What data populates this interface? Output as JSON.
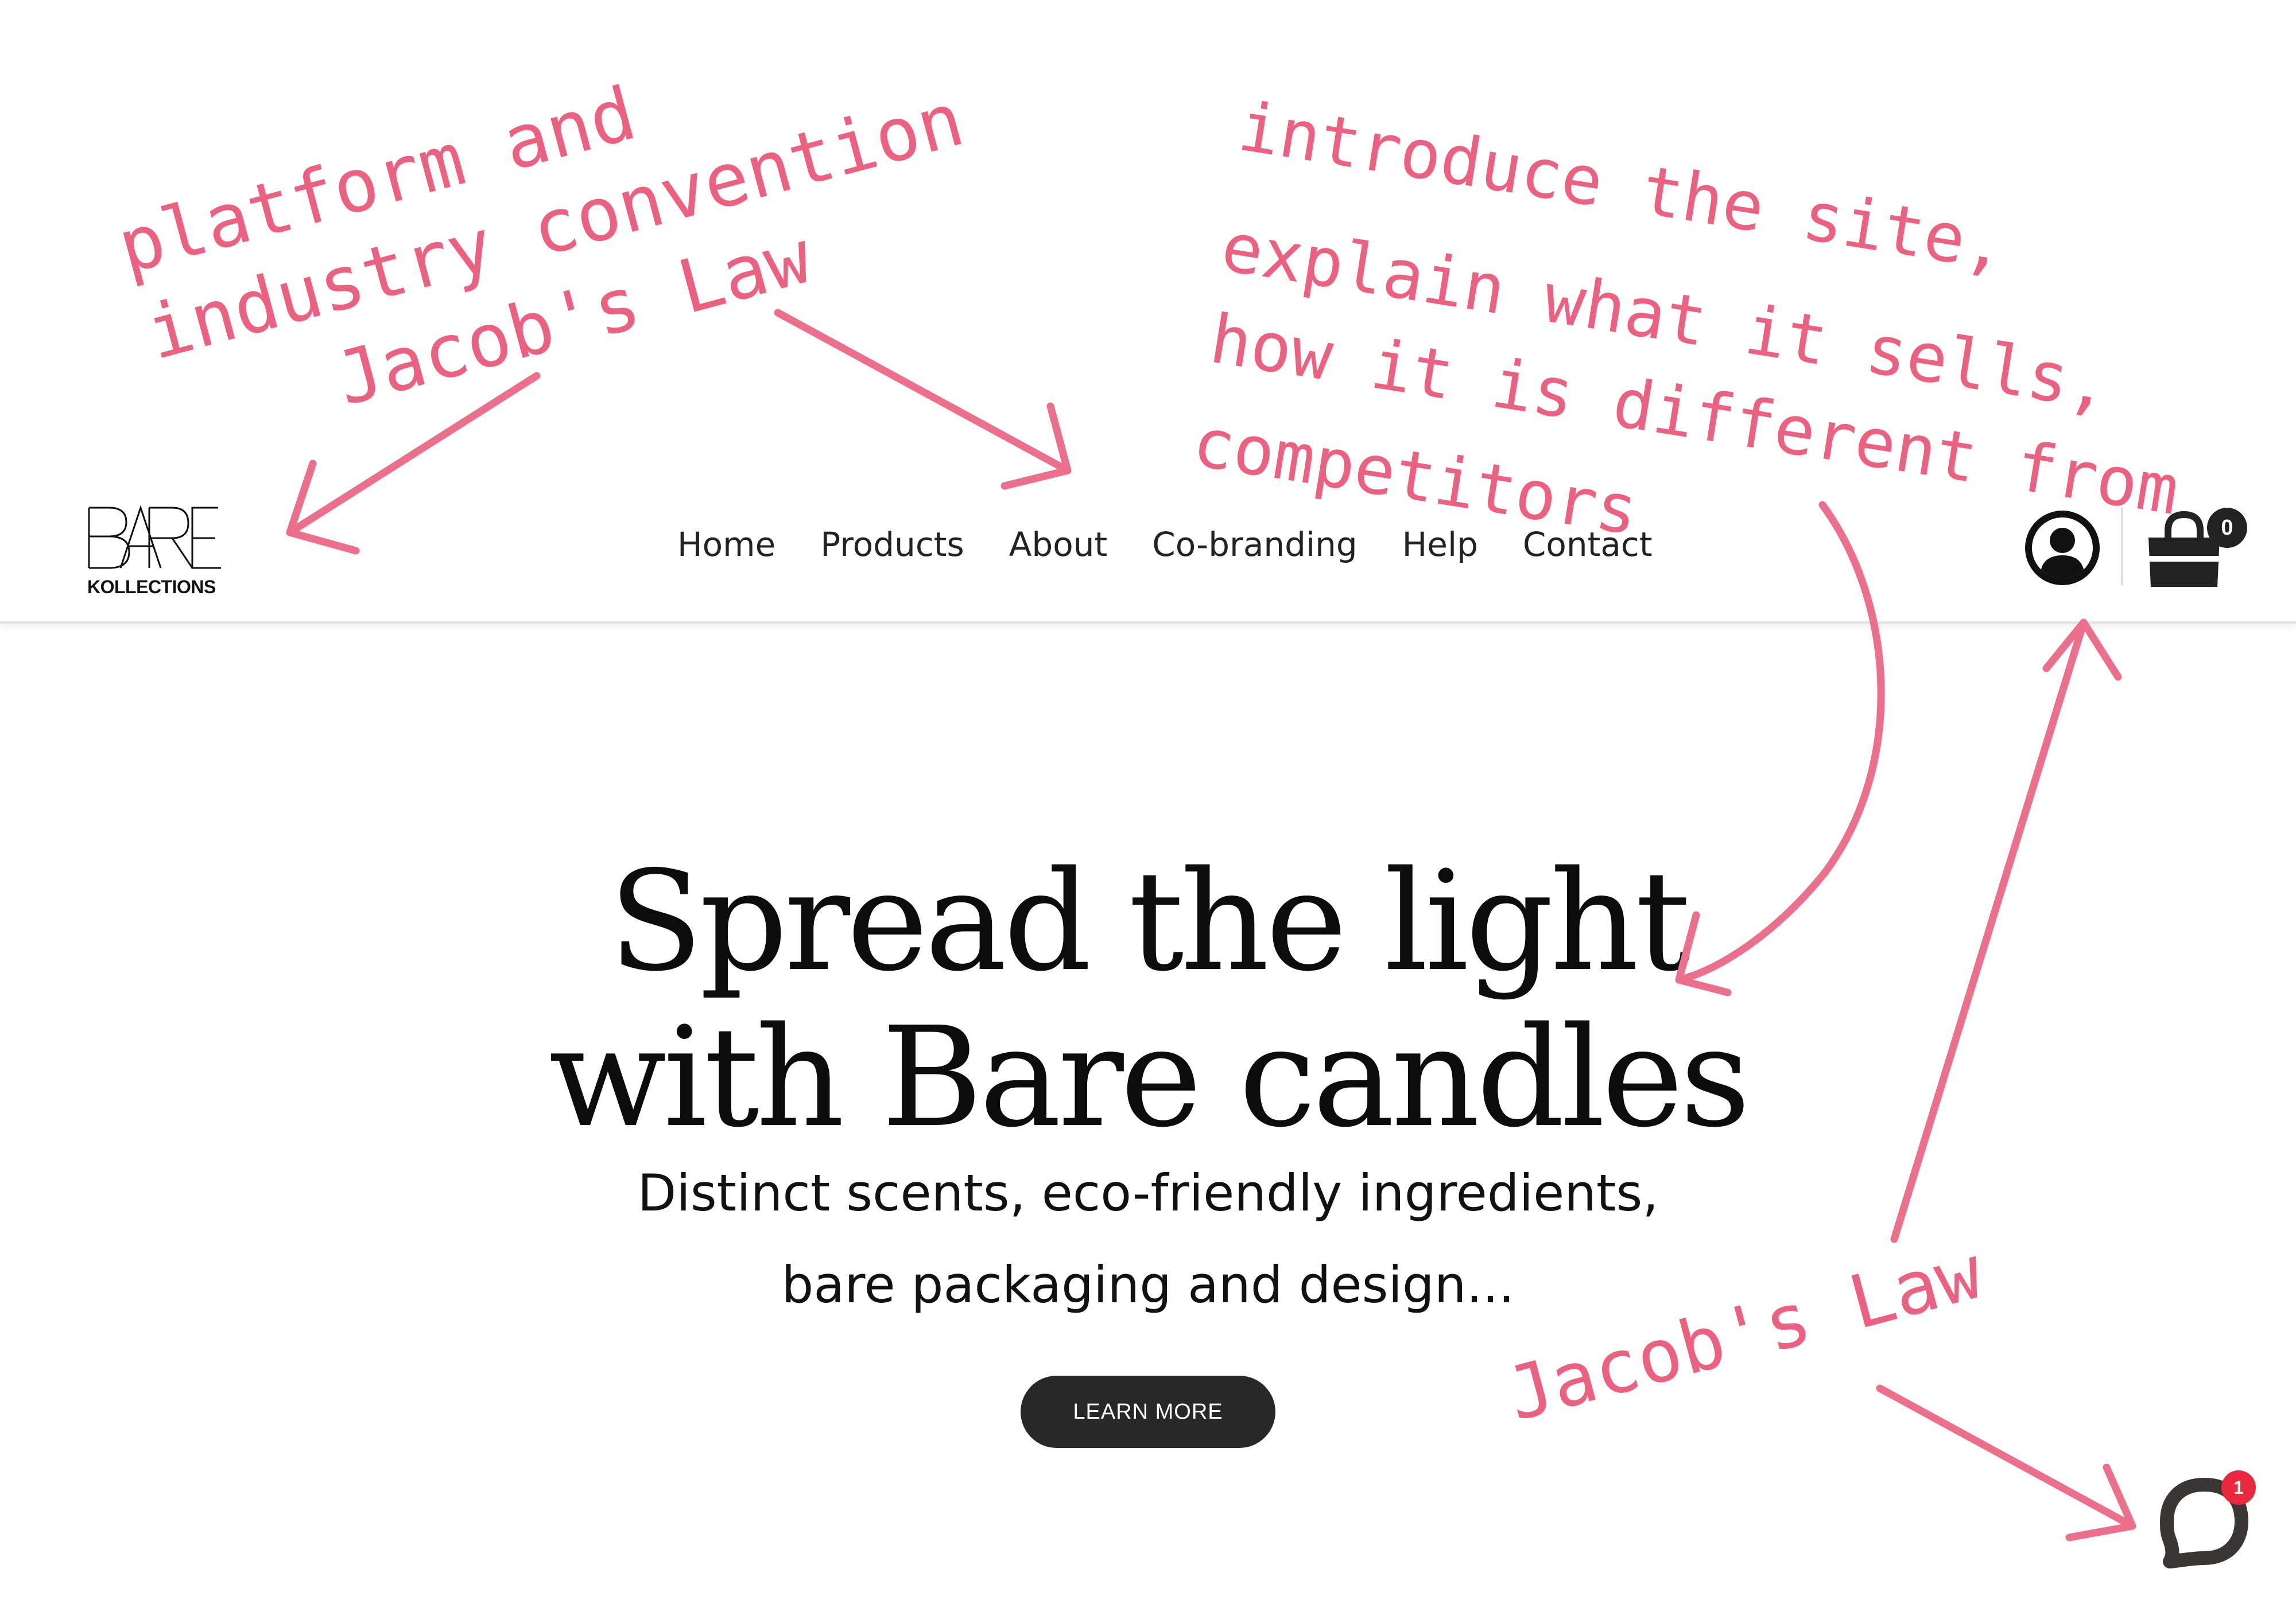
{
  "header": {
    "logo": {
      "mark": "BARE",
      "sub": "KOLLECTIONS"
    },
    "nav": [
      "Home",
      "Products",
      "About",
      "Co-branding",
      "Help",
      "Contact"
    ],
    "cart_count": "0"
  },
  "hero": {
    "title_line1": "Spread the light",
    "title_line2": "with Bare candles",
    "subtitle_line1": "Distinct scents, eco-friendly ingredients,",
    "subtitle_line2": "bare packaging and design...",
    "cta_label": "LEARN MORE"
  },
  "chat": {
    "badge": "1"
  },
  "annotations": {
    "left_line1": "platform and",
    "left_line2": "industry convention",
    "left_line3": "Jacob's Law",
    "right_line1": "introduce the site,",
    "right_line2": "explain what it sells,",
    "right_line3": "how it is different from",
    "right_line4": "competitors",
    "bottom": "Jacob's Law"
  },
  "colors": {
    "annotation": "#ec6080",
    "button": "#282828",
    "badge": "#e8283c"
  }
}
